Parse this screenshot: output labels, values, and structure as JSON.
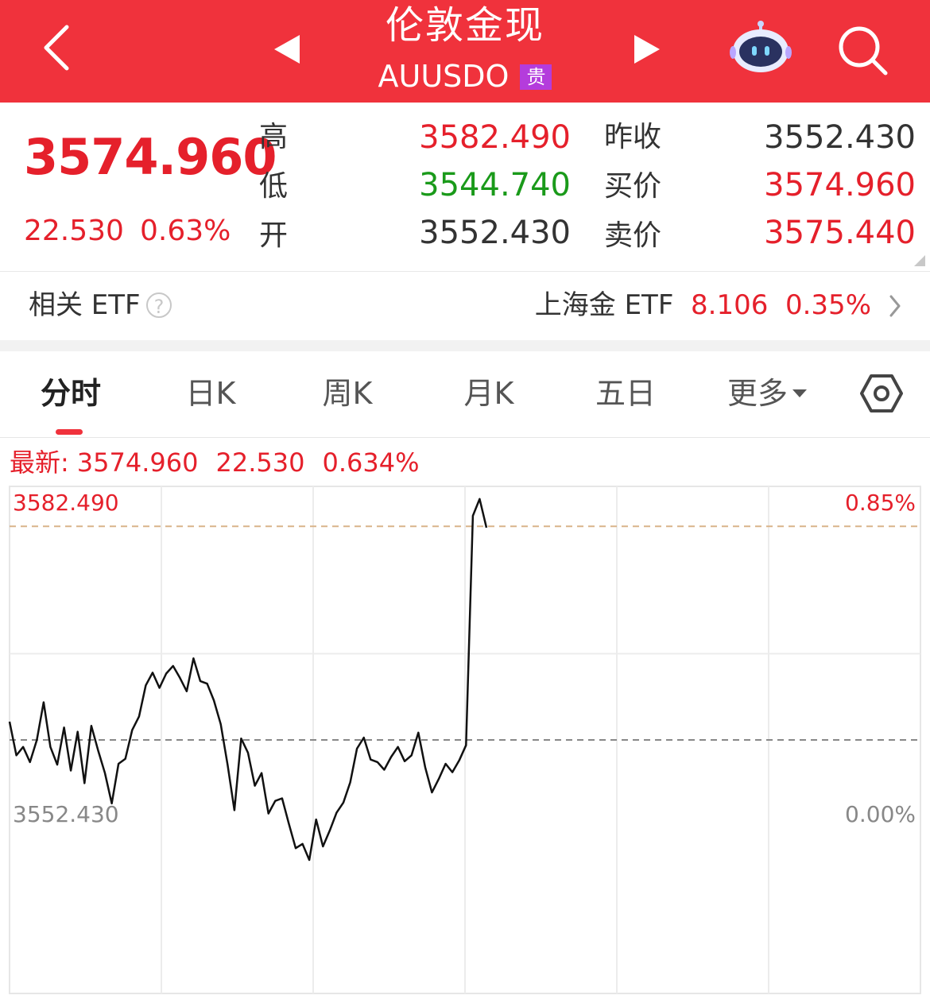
{
  "header": {
    "title": "伦敦金现",
    "symbol": "AUUSDO",
    "tag": "贵"
  },
  "quote": {
    "last": "3574.960",
    "change": "22.530",
    "change_pct": "0.63%",
    "rows": [
      {
        "label": "高",
        "value": "3582.490",
        "label2": "昨收",
        "value2": "3552.430"
      },
      {
        "label": "低",
        "value": "3544.740",
        "label2": "买价",
        "value2": "3574.960"
      },
      {
        "label": "开",
        "value": "3552.430",
        "label2": "卖价",
        "value2": "3575.440"
      }
    ]
  },
  "etf": {
    "label": "相关 ETF",
    "help": "?",
    "name": "上海金 ETF",
    "price": "8.106",
    "pct": "0.35%"
  },
  "tabs": [
    "分时",
    "日K",
    "周K",
    "月K",
    "五日",
    "更多"
  ],
  "latest": {
    "label": "最新:",
    "price": "3574.960",
    "change": "22.530",
    "pct": "0.634%"
  },
  "colors": {
    "accent": "#f0323c",
    "up": "#e5202b",
    "down": "#1a9a1a",
    "tag": "#b43cdc"
  },
  "chart_data": {
    "type": "line",
    "y_tick_left": {
      "top": "3582.490",
      "mid": "3552.430"
    },
    "y_tick_right": {
      "top": "0.85%",
      "mid": "0.00%"
    },
    "ylim": [
      3522.37,
      3582.49
    ],
    "reference_lines": [
      3552.43,
      3577.75
    ],
    "x": [
      0,
      1,
      2,
      3,
      4,
      5,
      6,
      7,
      8,
      9,
      10,
      11,
      12,
      13,
      14,
      15,
      16,
      17,
      18,
      19,
      20,
      21,
      22,
      23,
      24,
      25,
      26,
      27,
      28,
      29,
      30,
      31,
      32,
      33,
      34,
      35,
      36,
      37,
      38,
      39,
      40,
      41,
      42,
      43,
      44,
      45,
      46,
      47,
      48,
      49,
      50,
      51,
      52,
      53,
      54,
      55,
      56,
      57,
      58,
      59,
      60,
      61,
      62,
      63,
      64,
      65,
      66,
      67,
      68,
      69,
      70,
      71,
      72,
      73,
      74,
      75,
      76,
      77,
      78,
      79,
      80,
      81,
      82,
      83,
      84,
      85,
      86,
      87,
      88,
      89,
      90,
      91,
      92,
      93,
      94,
      95,
      96,
      97,
      98,
      99,
      100
    ],
    "series": [
      {
        "values": [
          3554.6,
          3550.6,
          3551.6,
          3549.8,
          3552.4,
          3556.9,
          3551.6,
          3549.5,
          3553.9,
          3548.8,
          3553.4,
          3547.3,
          3554.1,
          3551.2,
          3548.5,
          3544.9,
          3549.6,
          3550.2,
          3553.6,
          3555.2,
          3558.9,
          3560.4,
          3558.6,
          3560.3,
          3561.2,
          3559.8,
          3558.2,
          3562.1,
          3559.4,
          3559.1,
          3557.1,
          3554.3,
          3549.5,
          3544.1,
          3552.6,
          3550.9,
          3547.0,
          3548.5,
          3543.7,
          3545.2,
          3545.5,
          3542.5,
          3539.6,
          3540.1,
          3538.2,
          3543.0,
          3539.8,
          3541.7,
          3543.8,
          3545.0,
          3547.4,
          3551.4,
          3552.7,
          3550.1,
          3549.8,
          3548.9,
          3550.4,
          3551.6,
          3549.9,
          3550.6,
          3553.3,
          3549.2,
          3546.2,
          3547.8,
          3549.6,
          3548.6,
          3550.0,
          3551.8,
          3579.0,
          3581.0,
          3577.6
        ],
        "note_x_is_index": true
      }
    ]
  }
}
